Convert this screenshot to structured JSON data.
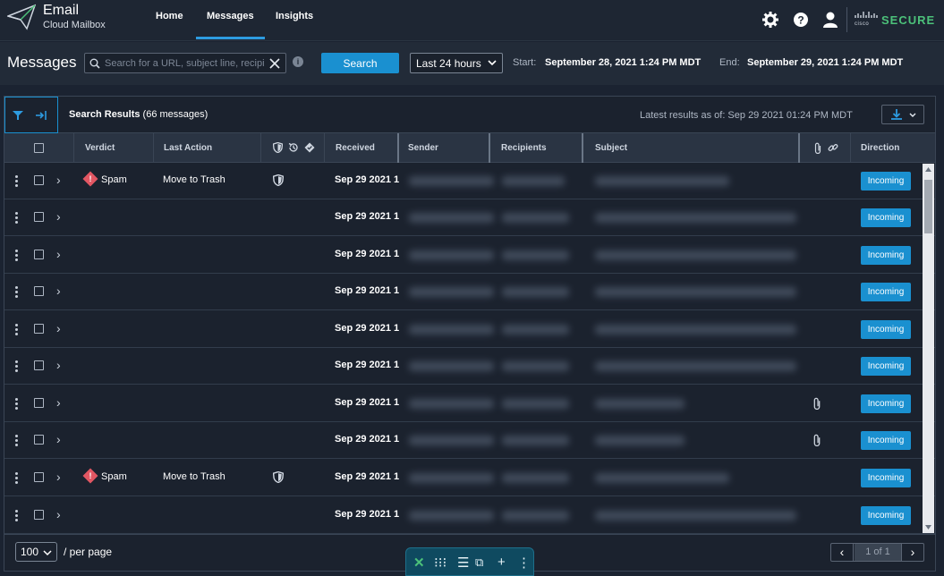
{
  "brand": {
    "title": "Email",
    "subtitle": "Cloud Mailbox"
  },
  "nav": {
    "tabs": [
      "Home",
      "Messages",
      "Insights"
    ],
    "active": "Messages"
  },
  "top_icons": [
    "gear-icon",
    "help-icon",
    "user-icon",
    "cisco-logo"
  ],
  "vendor": {
    "cisco": "cisco",
    "secure": "SECURE"
  },
  "header": {
    "title": "Messages",
    "search_placeholder": "Search for a URL, subject line, recipi",
    "search_button": "Search",
    "time_range": "Last 24 hours",
    "start_label": "Start:",
    "start_value": "September 28, 2021 1:24 PM MDT",
    "end_label": "End:",
    "end_value": "September 29, 2021 1:24 PM MDT"
  },
  "results": {
    "title": "Search Results",
    "count": "(66 messages)",
    "latest": "Latest results as of: Sep 29 2021 01:24 PM MDT"
  },
  "columns": [
    "Verdict",
    "Last Action",
    "Received",
    "Sender",
    "Recipients",
    "Subject",
    "Direction"
  ],
  "rows": [
    {
      "verdict": "Spam",
      "action": "Move to Trash",
      "shield": true,
      "received": "Sep 29 2021 1",
      "attach": false,
      "direction": "Incoming"
    },
    {
      "verdict": "",
      "action": "",
      "shield": false,
      "received": "Sep 29 2021 1",
      "attach": false,
      "direction": "Incoming"
    },
    {
      "verdict": "",
      "action": "",
      "shield": false,
      "received": "Sep 29 2021 1",
      "attach": false,
      "direction": "Incoming"
    },
    {
      "verdict": "",
      "action": "",
      "shield": false,
      "received": "Sep 29 2021 1",
      "attach": false,
      "direction": "Incoming"
    },
    {
      "verdict": "",
      "action": "",
      "shield": false,
      "received": "Sep 29 2021 1",
      "attach": false,
      "direction": "Incoming"
    },
    {
      "verdict": "",
      "action": "",
      "shield": false,
      "received": "Sep 29 2021 1",
      "attach": false,
      "direction": "Incoming"
    },
    {
      "verdict": "",
      "action": "",
      "shield": false,
      "received": "Sep 29 2021 1",
      "attach": true,
      "direction": "Incoming"
    },
    {
      "verdict": "",
      "action": "",
      "shield": false,
      "received": "Sep 29 2021 1",
      "attach": true,
      "direction": "Incoming"
    },
    {
      "verdict": "Spam",
      "action": "Move to Trash",
      "shield": true,
      "received": "Sep 29 2021 1",
      "attach": false,
      "direction": "Incoming"
    },
    {
      "verdict": "",
      "action": "",
      "shield": false,
      "received": "Sep 29 2021 1",
      "attach": false,
      "direction": "Incoming"
    }
  ],
  "pagination": {
    "per_page": "100",
    "per_page_label": "/ per page",
    "page_info": "1 of 1"
  },
  "colors": {
    "accent": "#1a90d0",
    "spam": "#e25763",
    "secure": "#4cc17a"
  }
}
